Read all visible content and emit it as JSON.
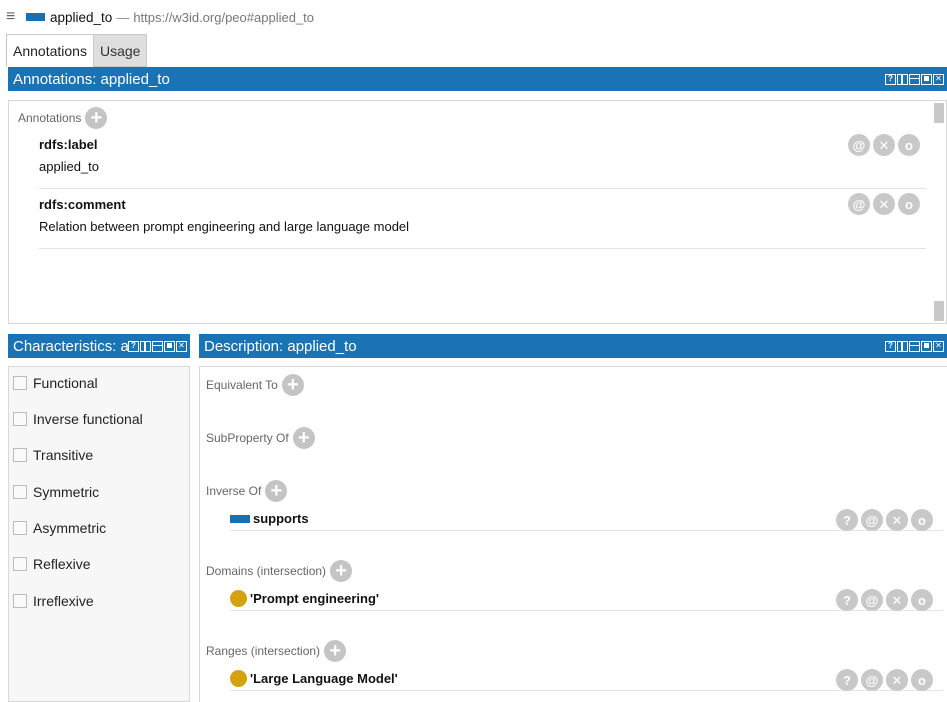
{
  "title": {
    "entity_name": "applied_to",
    "separator": "—",
    "iri": "https://w3id.org/peo#applied_to"
  },
  "tabs": [
    {
      "label": "Annotations",
      "active": true
    },
    {
      "label": "Usage",
      "active": false
    }
  ],
  "annotations_panel": {
    "header": "Annotations: applied_to",
    "section_label": "Annotations",
    "items": [
      {
        "property": "rdfs:label",
        "value": "applied_to"
      },
      {
        "property": "rdfs:comment",
        "value": "Relation between prompt engineering and large language model"
      }
    ]
  },
  "characteristics_panel": {
    "header": "Characteristics: applied_to",
    "items": [
      {
        "label": "Functional",
        "checked": false
      },
      {
        "label": "Inverse functional",
        "checked": false
      },
      {
        "label": "Transitive",
        "checked": false
      },
      {
        "label": "Symmetric",
        "checked": false
      },
      {
        "label": "Asymmetric",
        "checked": false
      },
      {
        "label": "Reflexive",
        "checked": false
      },
      {
        "label": "Irreflexive",
        "checked": false
      }
    ]
  },
  "description_panel": {
    "header": "Description: applied_to",
    "sections": {
      "equivalent_to": "Equivalent To",
      "subproperty_of": "SubProperty Of",
      "inverse_of": "Inverse Of",
      "domains": "Domains (intersection)",
      "ranges": "Ranges (intersection)"
    },
    "inverse_of_items": [
      {
        "name": "supports",
        "icon": "object-property-icon"
      }
    ],
    "domains_items": [
      {
        "name": "'Prompt engineering'",
        "icon": "class-icon"
      }
    ],
    "ranges_items": [
      {
        "name": "'Large Language Model'",
        "icon": "class-icon"
      }
    ]
  },
  "header_controls": {
    "help": "?"
  },
  "row_button_glyphs": {
    "help": "?",
    "annotate": "@",
    "delete": "✕",
    "edit": "o",
    "add": "+"
  },
  "colors": {
    "header_blue": "#1a73b4",
    "property_blue": "#1a6fb0",
    "class_gold": "#d2a30f",
    "button_gray": "#c8c8c8"
  }
}
